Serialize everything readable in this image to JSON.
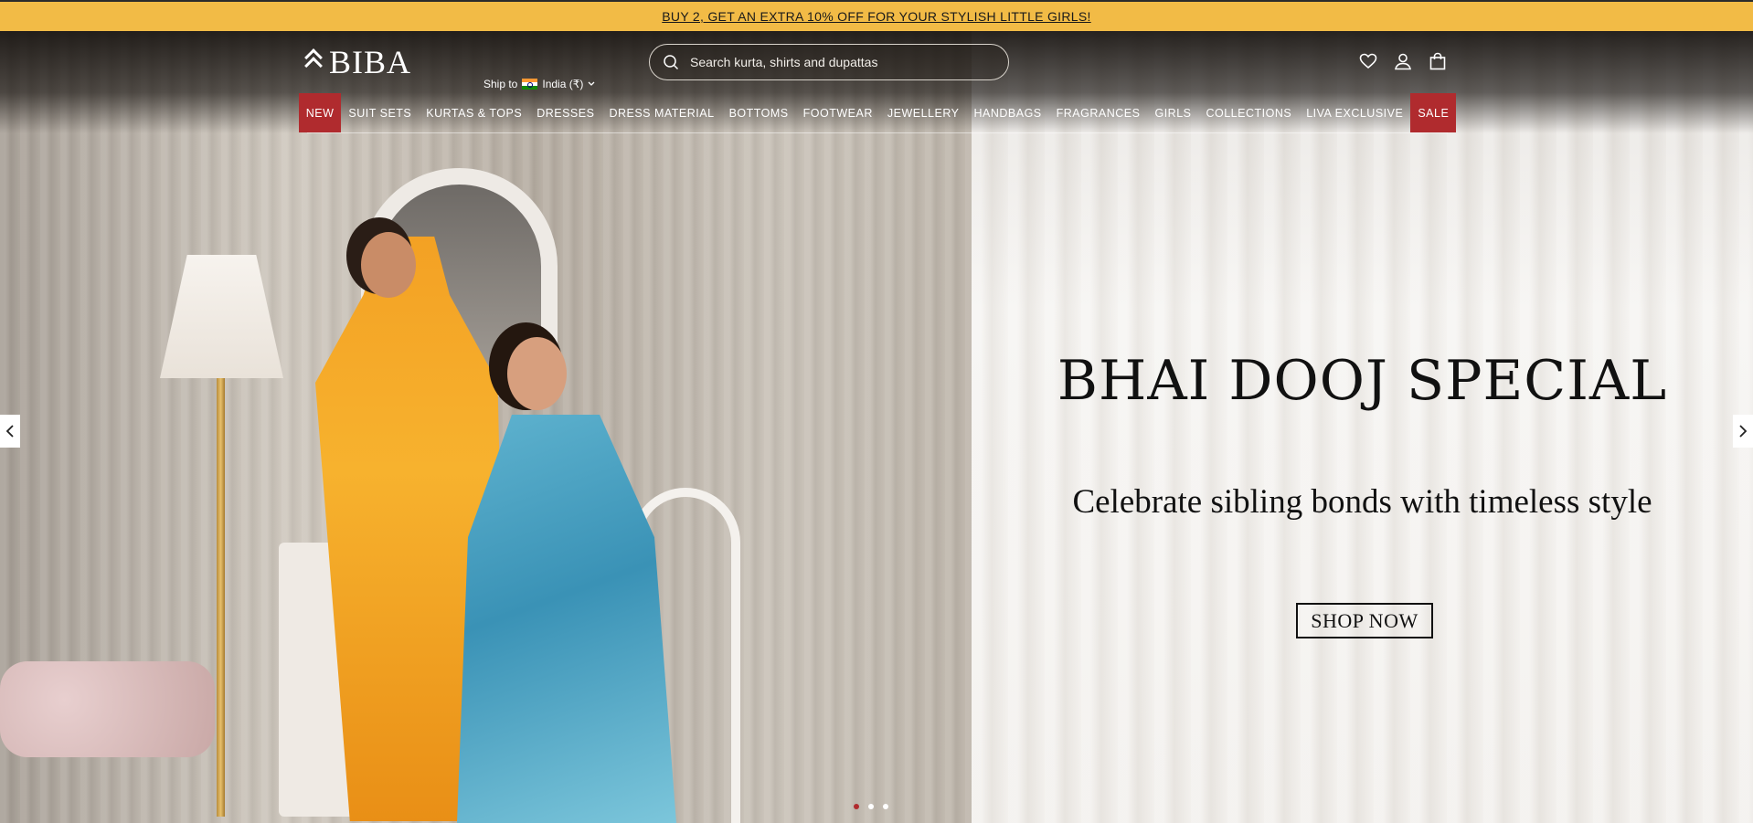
{
  "promo": {
    "text": "BUY 2, GET AN EXTRA 10% OFF FOR YOUR STYLISH LITTLE GIRLS!",
    "background_color": "#f2bb46"
  },
  "header": {
    "logo_text": "BIBA",
    "ship_to": {
      "label": "Ship to",
      "country": "India (₹)"
    },
    "search": {
      "placeholder": "Search kurta, shirts and dupattas",
      "value": ""
    },
    "icons": [
      "heart-icon",
      "user-icon",
      "shopping-bag-icon"
    ]
  },
  "nav": {
    "items": [
      {
        "label": "NEW",
        "highlight": true
      },
      {
        "label": "SUIT SETS",
        "highlight": false
      },
      {
        "label": "KURTAS & TOPS",
        "highlight": false
      },
      {
        "label": "DRESSES",
        "highlight": false
      },
      {
        "label": "DRESS MATERIAL",
        "highlight": false
      },
      {
        "label": "BOTTOMS",
        "highlight": false
      },
      {
        "label": "FOOTWEAR",
        "highlight": false
      },
      {
        "label": "JEWELLERY",
        "highlight": false
      },
      {
        "label": "HANDBAGS",
        "highlight": false
      },
      {
        "label": "FRAGRANCES",
        "highlight": false
      },
      {
        "label": "GIRLS",
        "highlight": false
      },
      {
        "label": "COLLECTIONS",
        "highlight": false
      },
      {
        "label": "LIVA EXCLUSIVE",
        "highlight": false
      },
      {
        "label": "SALE",
        "highlight": true
      }
    ],
    "highlight_color": "#b02b2e"
  },
  "hero": {
    "title": "BHAI DOOJ SPECIAL",
    "subtitle": "Celebrate sibling bonds with timeless style",
    "cta": "SHOP NOW",
    "slides_total": 3,
    "active_slide": 1
  }
}
